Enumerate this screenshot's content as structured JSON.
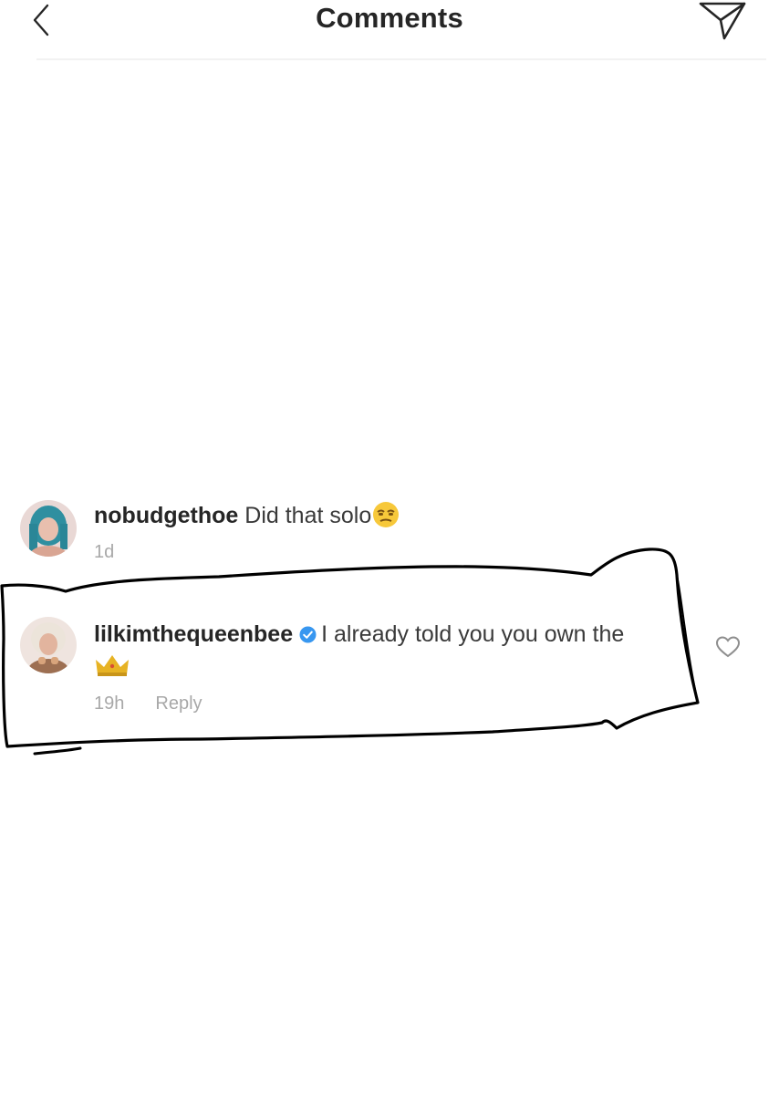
{
  "header": {
    "title": "Comments",
    "back_icon": "chevron-left-icon",
    "share_icon": "paper-plane-icon"
  },
  "comments": [
    {
      "username": "nobudgethoe",
      "text": "Did that solo",
      "emoji": "unamused-face",
      "time": "1d",
      "verified": false
    },
    {
      "username": "lilkimthequeenbee",
      "text": "I already told you you own the",
      "emoji": "crown",
      "time": "19h",
      "reply_label": "Reply",
      "verified": true,
      "like_icon": "heart-outline-icon"
    }
  ],
  "colors": {
    "text": "#262626",
    "secondary": "#a8a8a8",
    "verified": "#3897f0",
    "annotation": "#000000"
  }
}
